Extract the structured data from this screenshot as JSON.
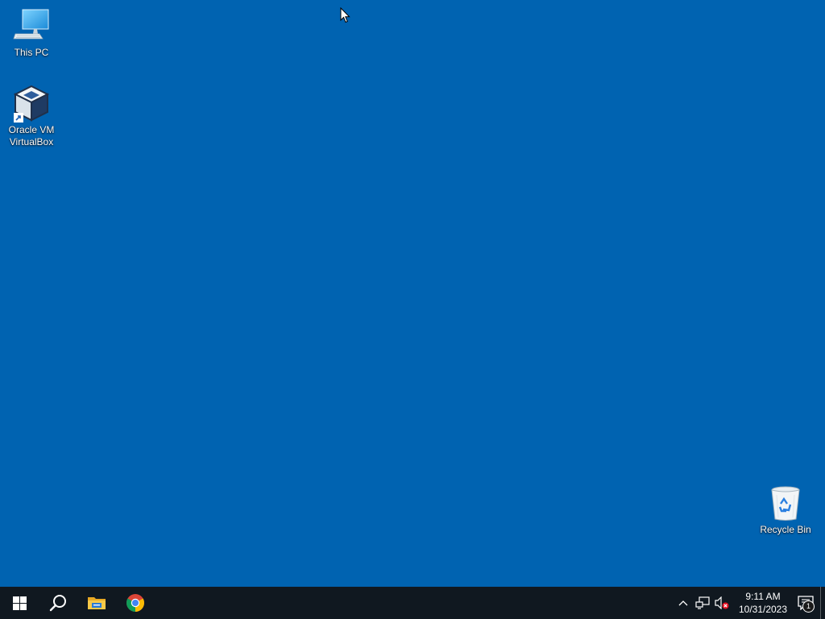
{
  "desktop": {
    "background_color": "#0063b1",
    "icons": [
      {
        "label": "This PC",
        "icon": "computer-icon"
      },
      {
        "label": "Oracle VM\nVirtualBox",
        "icon": "virtualbox-icon"
      },
      {
        "label": "Recycle Bin",
        "icon": "recycle-bin-icon"
      }
    ]
  },
  "taskbar": {
    "background_color": "#101820",
    "pinned": [
      {
        "icon": "windows-start-icon"
      },
      {
        "icon": "search-icon"
      },
      {
        "icon": "file-explorer-icon"
      },
      {
        "icon": "chrome-icon"
      }
    ],
    "tray": {
      "icons": [
        "chevron-up-icon",
        "network-icon",
        "volume-muted-icon"
      ],
      "time": "9:11 AM",
      "date": "10/31/2023",
      "notifications_count": "1"
    }
  }
}
